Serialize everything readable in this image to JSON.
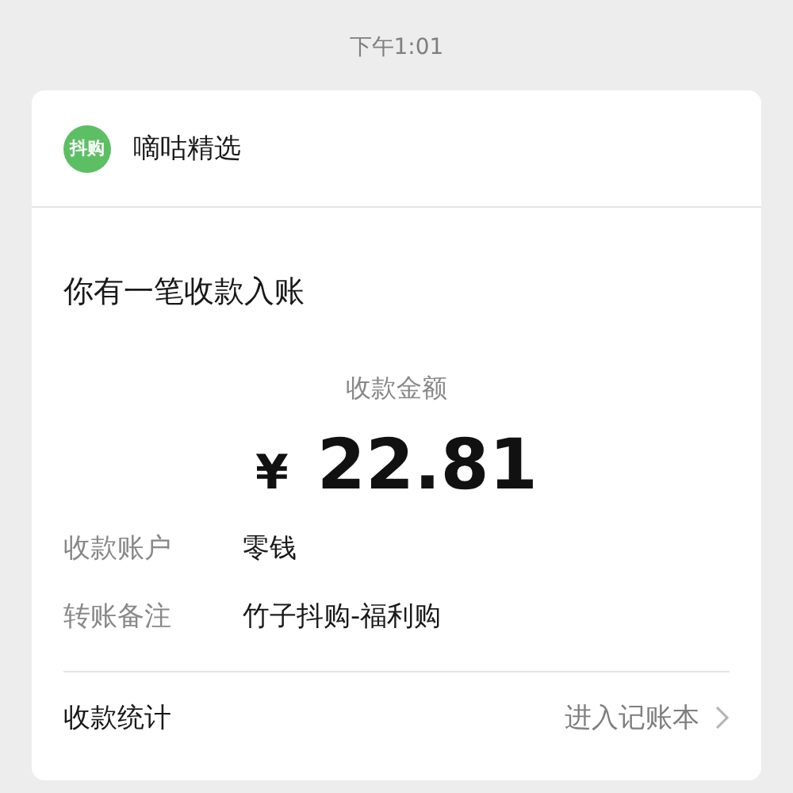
{
  "status_time": "下午1:01",
  "merchant": {
    "logo_text": "抖购",
    "name": "嘀咕精选"
  },
  "title": "你有一笔收款入账",
  "amount": {
    "label": "收款金额",
    "currency": "¥",
    "value": "22.81"
  },
  "details": [
    {
      "label": "收款账户",
      "value": "零钱"
    },
    {
      "label": "转账备注",
      "value": "竹子抖购-福利购"
    }
  ],
  "footer": {
    "label": "收款统计",
    "link": "进入记账本"
  }
}
